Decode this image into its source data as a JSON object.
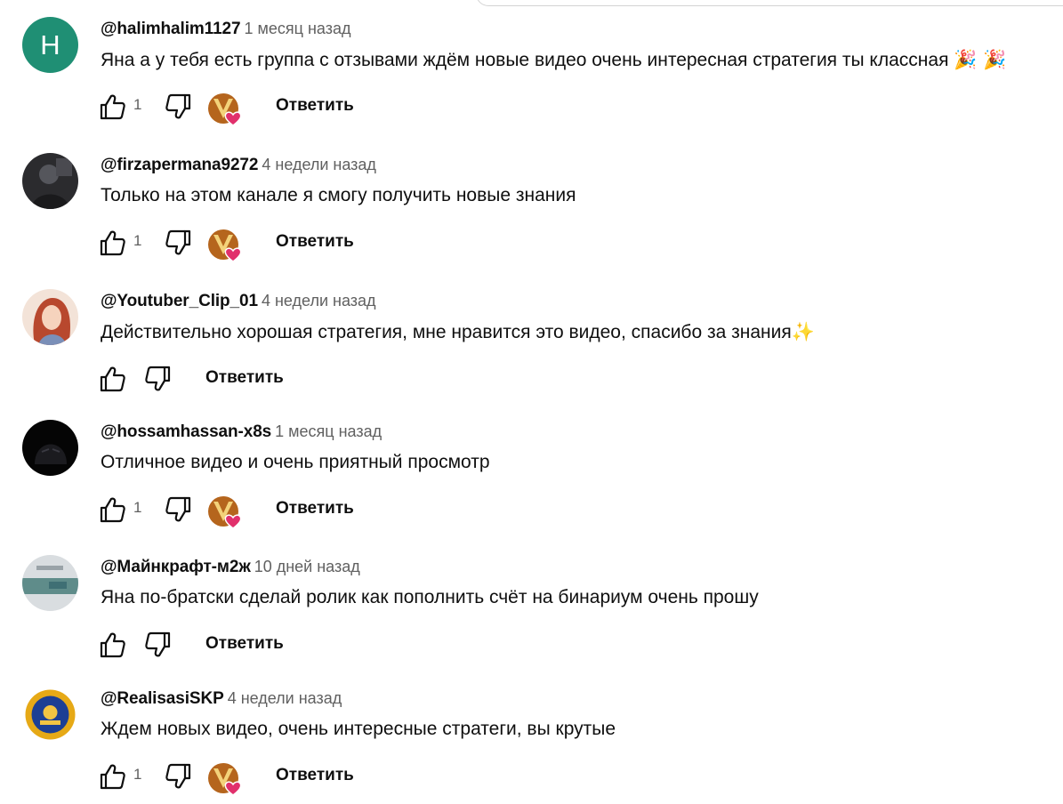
{
  "reply_label": "Ответить",
  "icons": {
    "like": "thumb-up-icon",
    "dislike": "thumb-down-icon",
    "creator_heart": "creator-heart-badge"
  },
  "colors": {
    "author": "#0f0f0f",
    "time": "#606060",
    "heart": "#e1306c",
    "letter_avatar": "#1f8f74"
  },
  "comments": [
    {
      "author": "@halimhalim1127",
      "time": "1 месяц назад",
      "text": "Яна а у тебя есть группа с отзывами ждём новые видео очень интересная стратегия ты классная",
      "emoji": "🎉 🎉",
      "likes": "1",
      "avatar_letter": "H",
      "hearted": true
    },
    {
      "author": "@firzapermana9272",
      "time": "4 недели назад",
      "text": "Только на этом канале я смогу получить новые знания",
      "emoji": "",
      "likes": "1",
      "hearted": true
    },
    {
      "author": "@Youtuber_Clip_01",
      "time": "4 недели назад",
      "text": "Действительно хорошая стратегия, мне нравится это видео, спасибо за знания",
      "emoji": "✨",
      "likes": "",
      "hearted": false
    },
    {
      "author": "@hossamhassan-x8s",
      "time": "1 месяц назад",
      "text": "Отличное видео и очень приятный просмотр",
      "emoji": "",
      "likes": "1",
      "hearted": true
    },
    {
      "author": "@Майнкрафт-м2ж",
      "time": "10 дней назад",
      "text": "Яна по-братски сделай ролик как пополнить счёт на бинариум очень прошу",
      "emoji": "",
      "likes": "",
      "hearted": false
    },
    {
      "author": "@RealisasiSKP",
      "time": "4 недели назад",
      "text": "Ждем новых видео, очень интересные стратеги, вы крутые",
      "emoji": "",
      "likes": "1",
      "hearted": true
    }
  ]
}
